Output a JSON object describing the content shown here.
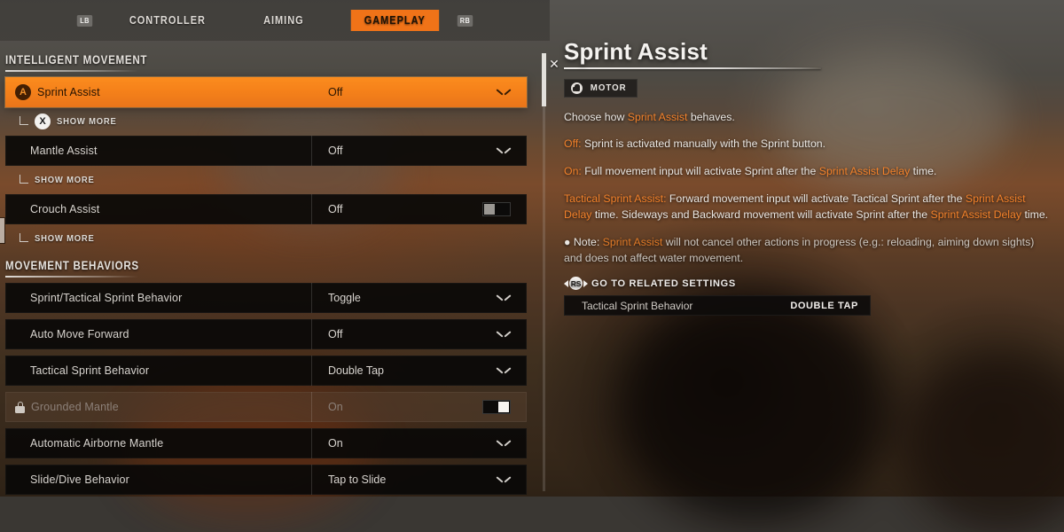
{
  "topbar": {
    "left_bumper": "LB",
    "right_bumper": "RB",
    "tabs": [
      {
        "label": "CONTROLLER",
        "active": false
      },
      {
        "label": "AIMING",
        "active": false
      },
      {
        "label": "GAMEPLAY",
        "active": true
      }
    ]
  },
  "settings": {
    "sections": [
      {
        "title": "INTELLIGENT MOVEMENT",
        "rows": [
          {
            "label": "Sprint Assist",
            "value": "Off",
            "control": "dropdown",
            "selected": true,
            "button_glyph": "A",
            "submore": "SHOW MORE",
            "submore_glyph": "X"
          },
          {
            "label": "Mantle Assist",
            "value": "Off",
            "control": "dropdown",
            "selected": false,
            "submore": "SHOW MORE"
          },
          {
            "label": "Crouch Assist",
            "value": "Off",
            "control": "toggle-off",
            "selected": false,
            "submore": "SHOW MORE"
          }
        ]
      },
      {
        "title": "MOVEMENT BEHAVIORS",
        "rows": [
          {
            "label": "Sprint/Tactical Sprint Behavior",
            "value": "Toggle",
            "control": "dropdown"
          },
          {
            "label": "Auto Move Forward",
            "value": "Off",
            "control": "dropdown"
          },
          {
            "label": "Tactical Sprint Behavior",
            "value": "Double Tap",
            "control": "dropdown"
          },
          {
            "label": "Grounded Mantle",
            "value": "On",
            "control": "toggle-on",
            "locked": true
          },
          {
            "label": "Automatic Airborne Mantle",
            "value": "On",
            "control": "dropdown"
          },
          {
            "label": "Slide/Dive Behavior",
            "value": "Tap to Slide",
            "control": "dropdown"
          }
        ]
      }
    ]
  },
  "detail": {
    "close_label": "✕",
    "title": "Sprint Assist",
    "badge": {
      "label": "MOTOR",
      "icon": "hand-icon"
    },
    "p1_a": "Choose how ",
    "p1_hl": "Sprint Assist",
    "p1_b": " behaves.",
    "p2_hl": "Off:",
    "p2_b": " Sprint is activated manually with the Sprint button.",
    "p3_hl": "On:",
    "p3_b": " Full movement input will activate Sprint after the ",
    "p3_hl2": "Sprint Assist Delay",
    "p3_c": " time.",
    "p4_hl": "Tactical Sprint Assist:",
    "p4_b": " Forward movement input will activate Tactical Sprint after the ",
    "p4_hl2": "Sprint Assist Delay",
    "p4_c": " time. Sideways and Backward movement will activate Sprint after the ",
    "p4_hl3": "Sprint Assist Delay",
    "p4_d": " time.",
    "p5_bullet": "● Note: ",
    "p5_hl": "Sprint Assist",
    "p5_b": " will not cancel other actions in progress (e.g.: reloading, aiming down sights) and does not affect water movement.",
    "related_label": "GO TO RELATED SETTINGS",
    "related_button": "RS",
    "related_row": {
      "name": "Tactical Sprint Behavior",
      "value": "DOUBLE TAP"
    }
  },
  "colors": {
    "accent": "#f07318",
    "accent_text": "#f2812a",
    "row_bg": "#0a0908",
    "text": "#d8d4cf"
  }
}
